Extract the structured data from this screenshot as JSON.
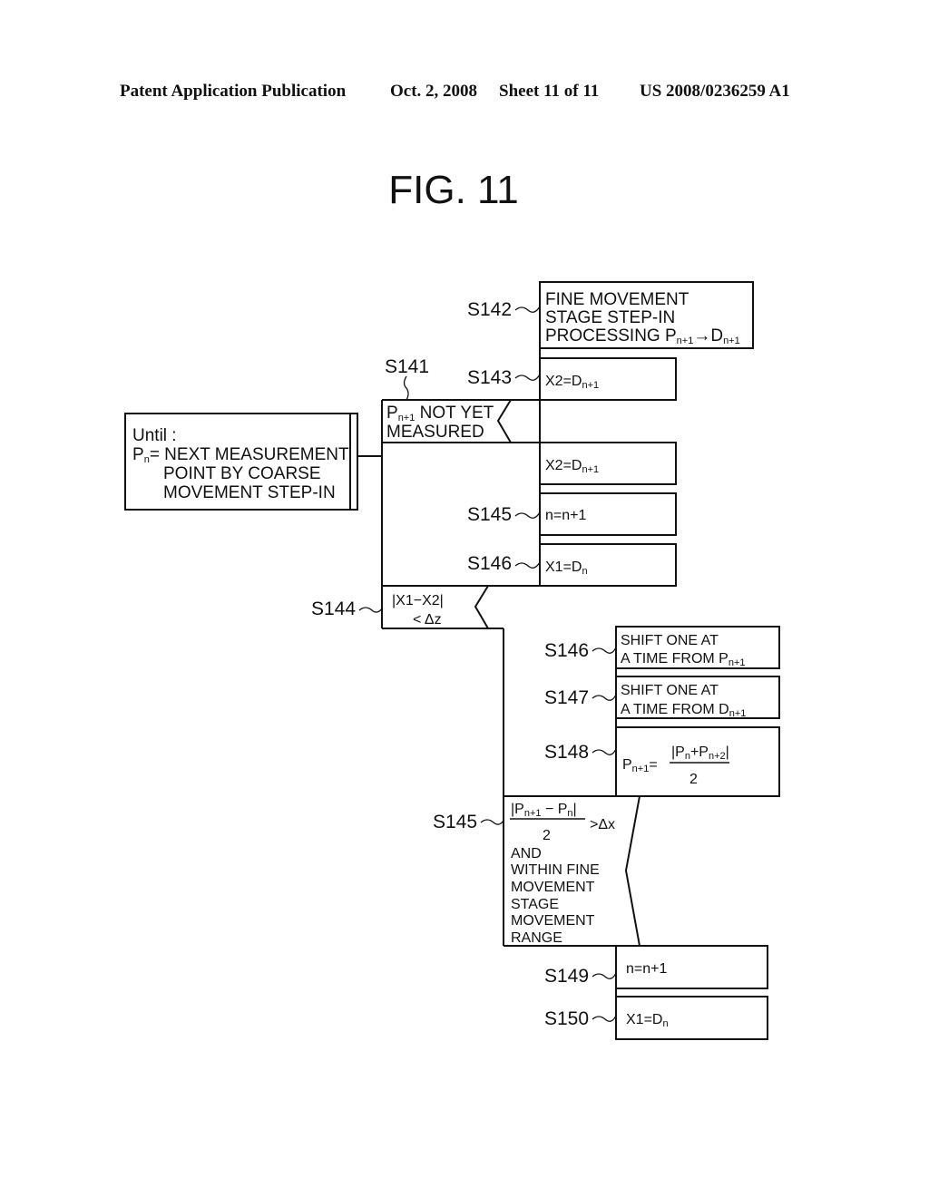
{
  "header": {
    "publication": "Patent Application Publication",
    "date": "Oct. 2, 2008",
    "sheet": "Sheet 11 of 11",
    "number": "US 2008/0236259 A1"
  },
  "figure": {
    "title": "FIG. 11"
  },
  "loop": {
    "line1": "Until :",
    "line2_var": "P",
    "line2_sub": "n",
    "line2_rest": "= NEXT MEASUREMENT",
    "line3": "POINT BY COARSE",
    "line4": "MOVEMENT STEP-IN"
  },
  "steps": {
    "s141": {
      "label": "S141",
      "line1_var": "P",
      "line1_sub": "n+1",
      "line1_rest": " NOT YET",
      "line2": "MEASURED"
    },
    "s142": {
      "label": "S142",
      "line1": "FINE MOVEMENT",
      "line2": "STAGE STEP-IN",
      "line3": "PROCESSING P",
      "sub1": "n+1",
      "arrow": "→D",
      "sub2": "n+1"
    },
    "s143": {
      "label": "S143",
      "text": "X2=D",
      "sub": "n+1"
    },
    "s143b": {
      "text": "X2=D",
      "sub": "n+1"
    },
    "s145a": {
      "label": "S145",
      "text": "n=n+1"
    },
    "s146a": {
      "label": "S146",
      "text": "X1=D",
      "sub": "n"
    },
    "s144": {
      "label": "S144",
      "line1": "|X1−X2|",
      "line2": "< Δz"
    },
    "s146b": {
      "label": "S146",
      "line1": "SHIFT ONE AT",
      "line2": "A TIME FROM P",
      "sub": "n+1"
    },
    "s147": {
      "label": "S147",
      "line1": "SHIFT ONE AT",
      "line2": "A TIME FROM D",
      "sub": "n+1"
    },
    "s148": {
      "label": "S148",
      "lhs": "P",
      "lhs_sub": "n+1",
      "eq": "=",
      "num": "|P",
      "num_sub1": "n",
      "num_mid": "+P",
      "num_sub2": "n+2",
      "num_end": "|",
      "den": "2"
    },
    "s145b": {
      "label": "S145",
      "num": "|P",
      "num_sub1": "n+1",
      "num_mid": " − P",
      "num_sub2": "n",
      "num_end": "|",
      "den": "2",
      "cmp": ">Δx",
      "line3": "AND",
      "line4": "WITHIN FINE",
      "line5": "MOVEMENT",
      "line6": "STAGE",
      "line7": "MOVEMENT",
      "line8": "RANGE"
    },
    "s149": {
      "label": "S149",
      "text": "n=n+1"
    },
    "s150": {
      "label": "S150",
      "text": "X1=D",
      "sub": "n"
    }
  }
}
